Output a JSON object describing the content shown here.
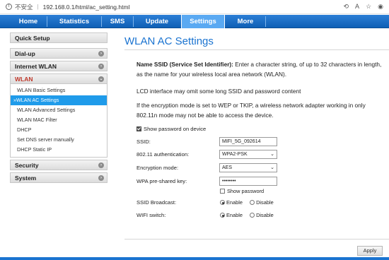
{
  "browser": {
    "security_label": "不安全",
    "separator": "|",
    "url": "192.168.0.1/html/ac_setting.html",
    "icons": [
      "read-aloud-icon",
      "translate-icon",
      "favorite-icon",
      "profile-icon"
    ]
  },
  "nav": {
    "tabs": [
      {
        "label": "Home"
      },
      {
        "label": "Statistics"
      },
      {
        "label": "SMS"
      },
      {
        "label": "Update"
      },
      {
        "label": "Settings",
        "active": true
      },
      {
        "label": "More"
      }
    ]
  },
  "sidebar": {
    "quick_setup": "Quick Setup",
    "dialup": "Dial-up",
    "internet_wlan": "Internet WLAN",
    "wlan": "WLAN",
    "wlan_items": [
      "WLAN Basic Settings",
      "WLAN AC Settings",
      "WLAN Advanced Settings",
      "WLAN MAC Filter",
      "DHCP",
      "Set DNS server manually",
      "DHCP Static IP"
    ],
    "active_prefix": "»",
    "security": "Security",
    "system": "System"
  },
  "main": {
    "title": "WLAN AC Settings",
    "intro_bold": "Name SSID (Service Set Identifier):",
    "intro_rest": " Enter a character string, of up to 32 characters in length, as the name for your wireless local area network (WLAN).",
    "lcd_note": "LCD interface may omit some long SSID and password content",
    "wep_note": "If the encryption mode is set to WEP or TKIP, a wireless network adapter working in only 802.11n mode may not be able to access the device.",
    "show_pw_device": "Show password on device",
    "ssid_label": "SSID:",
    "ssid_value": "MIFI_5G_092614",
    "auth_label": "802.11 authentication:",
    "auth_value": "WPA2-PSK",
    "enc_label": "Encryption mode:",
    "enc_value": "AES",
    "psk_label": "WPA pre-shared key:",
    "psk_value": "••••••••",
    "show_password": "Show password",
    "broadcast_label": "SSID Broadcast:",
    "wifi_label": "WIFI switch:",
    "enable": "Enable",
    "disable": "Disable",
    "apply": "Apply"
  }
}
